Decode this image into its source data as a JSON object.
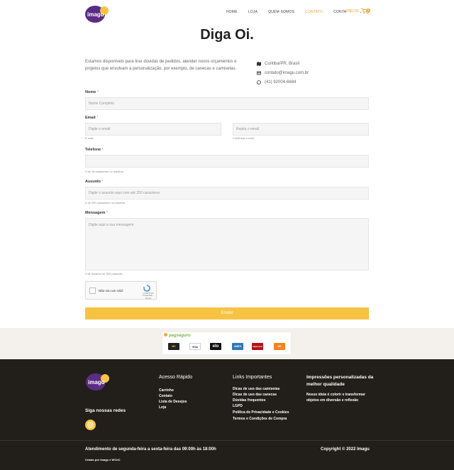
{
  "header": {
    "nav": [
      "HOME",
      "LOJA",
      "QUEM SOMOS",
      "CONTATO",
      "CONTA"
    ],
    "active_nav": "CONTATO",
    "cart_total": "R$0,00",
    "cart_count": "0",
    "logo_text": "imagu"
  },
  "page": {
    "title": "Diga Oi.",
    "intro": "Estamos disponíveis para tirar dúvidas de pedidos, atender novos orçamentos e projetos que envolvam a personalização, por exemplo, de canecas e camisetas.",
    "contacts": [
      {
        "icon": "map-icon",
        "text": "Curitiba/PR, Brasil"
      },
      {
        "icon": "envelope-icon",
        "text": "contato@imagu.com.br"
      },
      {
        "icon": "whatsapp-icon",
        "text": "(41) 92004-6684"
      }
    ]
  },
  "form": {
    "name_label": "Nome",
    "name_placeholder": "Nome Completo",
    "email_label": "Email",
    "email_placeholder": "Digite o email",
    "email_hint": "E-mail",
    "email_confirm_placeholder": "Repita o email",
    "email_confirm_hint": "Confirmar e-mail",
    "phone_label": "Telefone",
    "phone_hint": "0 de 15 caracteres no máximo.",
    "subject_label": "Assunto",
    "subject_placeholder": "Digite o assunto aqui com até 250 caracteres",
    "subject_hint": "0 de 250 caracteres no máximo.",
    "message_label": "Mensagem",
    "message_placeholder": "Digite aqui a sua mensagem",
    "message_hint": "0 de máximo de 500 palavras.",
    "required_mark": "*",
    "captcha_text": "Não sou um robô",
    "captcha_brand": "reCAPTCHA",
    "captcha_links": "Privacidade - Termos",
    "submit_label": "Enviar"
  },
  "payments": {
    "brand": "pagseguro",
    "cards": [
      "MC",
      "VISA",
      "elo",
      "AMEX",
      "Hipercard",
      "DC"
    ]
  },
  "footer": {
    "follow": "Siga nossas redes",
    "quick_title": "Acesso Rápido",
    "quick_links": [
      "Carrinho",
      "Contato",
      "Lista de Desejos",
      "Loja"
    ],
    "important_title": "Links Importantes",
    "important_links": [
      "Dicas de uso das camisetas",
      "Dicas de uso das canecas",
      "Dúvidas frequentes",
      "LGPD",
      "Política de Privacidade e Cookies",
      "Termos e Condições de Compra"
    ],
    "about_title": "Impressões personalizadas da melhor qualidade",
    "about_text": "Nosso ideia é colorir e transformar objetos em diversão e reflexão",
    "hours": "Atendimento de segunda-feira a sexta-feira das 09:00h às 18:00h",
    "copyright": "Copyright © 2022 Imagu",
    "credit": "Criado por Imagu e WChC"
  },
  "colors": {
    "accent": "#f6c343",
    "brand_purple": "#5b2c83",
    "footer_bg": "#221e1a"
  }
}
